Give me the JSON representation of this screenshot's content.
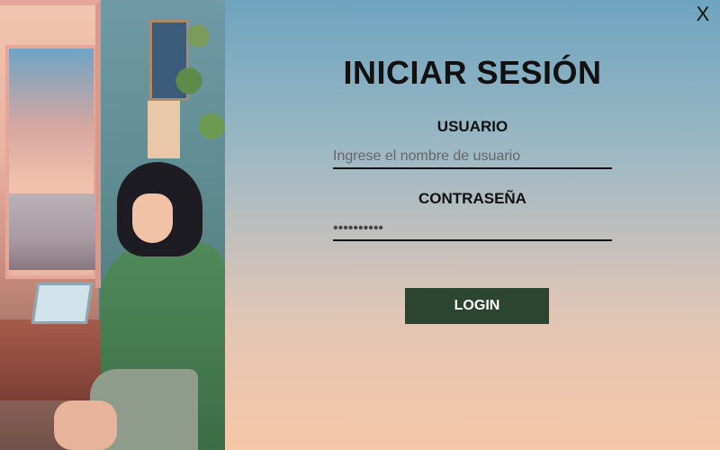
{
  "window": {
    "close_label": "X"
  },
  "login": {
    "title": "INICIAR SESIÓN",
    "username_label": "USUARIO",
    "username_placeholder": "Ingrese el nombre de usuario",
    "username_value": "",
    "password_label": "CONTRASEÑA",
    "password_value": "••••••••••",
    "login_button": "LOGIN"
  },
  "colors": {
    "button_bg": "#2b4531",
    "button_text": "#ffffff",
    "title_text": "#111111"
  }
}
